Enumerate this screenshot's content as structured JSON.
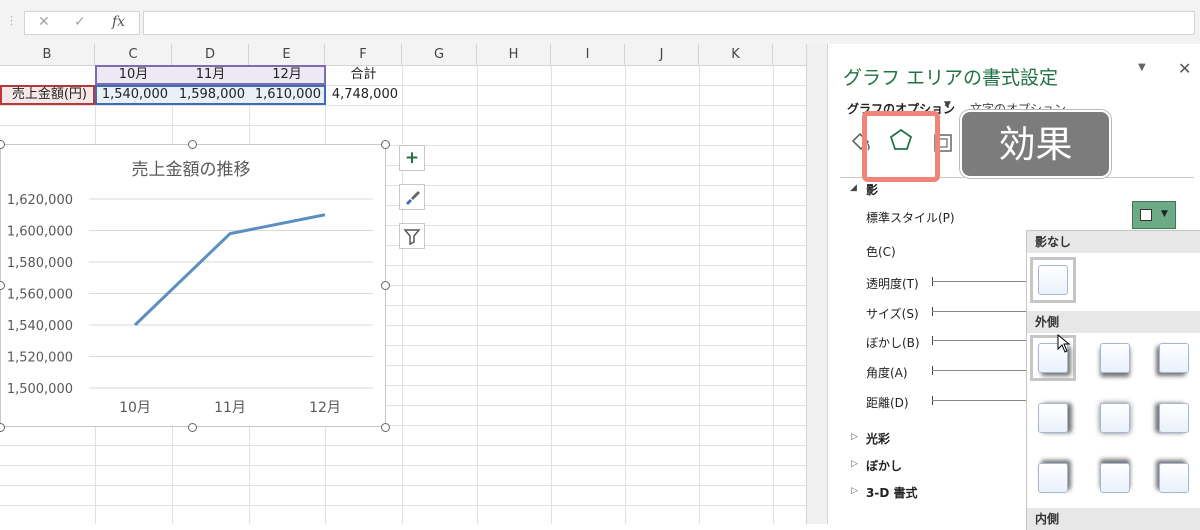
{
  "formula_bar": {
    "cancel_icon": "✕",
    "enter_icon": "✓",
    "fx_icon": "fx",
    "value": ""
  },
  "sheet": {
    "columns": [
      "B",
      "C",
      "D",
      "E",
      "F",
      "G",
      "H",
      "I",
      "J",
      "K"
    ],
    "header_row": {
      "C": "10月",
      "D": "11月",
      "E": "12月",
      "F": "合計"
    },
    "data_row": {
      "B": "売上金額(円)",
      "C": "1,540,000",
      "D": "1,598,000",
      "E": "1,610,000",
      "F": "4,748,000"
    }
  },
  "chart": {
    "element_buttons": {
      "add": "+",
      "style": "brush-icon",
      "filter": "filter-icon"
    },
    "chart_data": {
      "type": "line",
      "title": "売上金額の推移",
      "categories": [
        "10月",
        "11月",
        "12月"
      ],
      "series": [
        {
          "values": [
            1540000,
            1598000,
            1610000
          ]
        }
      ],
      "ylim": [
        1500000,
        1620000
      ],
      "y_ticks": [
        "1,620,000",
        "1,600,000",
        "1,580,000",
        "1,560,000",
        "1,540,000",
        "1,520,000",
        "1,500,000"
      ],
      "grid": true,
      "color": "#5b8fbf"
    }
  },
  "pane": {
    "title": "グラフ エリアの書式設定",
    "tabs": {
      "chart_options": "グラフのオプション",
      "text_options": "文字のオプション"
    },
    "shadow_section": "影",
    "rows": {
      "preset": "標準スタイル(P)",
      "color": "色(C)",
      "transparency": "透明度(T)",
      "size": "サイズ(S)",
      "blur": "ぼかし(B)",
      "angle": "角度(A)",
      "distance": "距離(D)"
    },
    "collapsed_sections": [
      "光彩",
      "ぼかし",
      "3-D 書式"
    ],
    "gallery": {
      "no_shadow": "影なし",
      "outer": "外側",
      "inner": "内側"
    }
  },
  "callout": "効果",
  "colors": {
    "accent_green": "#217346",
    "highlight": "#f08478",
    "callout_bg": "#7c7c7c"
  }
}
